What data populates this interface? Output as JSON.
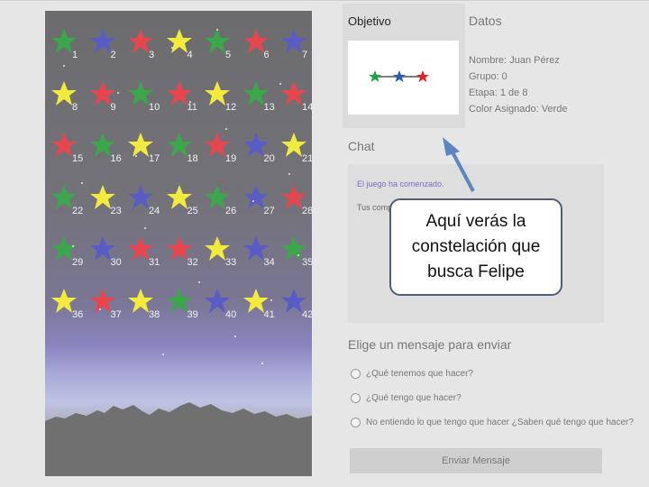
{
  "objective": {
    "title": "Objetivo",
    "colors": [
      "#1fa34a",
      "#2a5bb0",
      "#e0222a"
    ]
  },
  "datos": {
    "title": "Datos",
    "name": "Nombre: Juan Pérez",
    "group": "Grupo: 0",
    "stage": "Etapa: 1 de 8",
    "color": "Color Asignado: Verde"
  },
  "chat": {
    "title": "Chat",
    "message1": "El juego ha comenzado.",
    "message2": "Tus comp"
  },
  "callout": {
    "text": "Aquí verás la constelación que busca Felipe"
  },
  "send": {
    "title": "Elige un mensaje para enviar",
    "options": [
      "¿Qué tenemos que hacer?",
      "¿Qué tengo que hacer?",
      "No entiendo lo que tengo que hacer ¿Saben qué tengo que hacer?"
    ],
    "button": "Enviar Mensaje"
  },
  "palette": {
    "green": "#3aa74a",
    "blue": "#5a5cc6",
    "red": "#e8464e",
    "yellow": "#f2ea3c"
  },
  "stars": [
    {
      "n": "1",
      "c": "green"
    },
    {
      "n": "2",
      "c": "blue"
    },
    {
      "n": "3",
      "c": "red"
    },
    {
      "n": "4",
      "c": "yellow"
    },
    {
      "n": "5",
      "c": "green"
    },
    {
      "n": "6",
      "c": "red"
    },
    {
      "n": "7",
      "c": "blue"
    },
    {
      "n": "8",
      "c": "yellow"
    },
    {
      "n": "9",
      "c": "red"
    },
    {
      "n": "10",
      "c": "green"
    },
    {
      "n": "11",
      "c": "red"
    },
    {
      "n": "12",
      "c": "yellow"
    },
    {
      "n": "13",
      "c": "green"
    },
    {
      "n": "14",
      "c": "red"
    },
    {
      "n": "15",
      "c": "red"
    },
    {
      "n": "16",
      "c": "green"
    },
    {
      "n": "17",
      "c": "yellow"
    },
    {
      "n": "18",
      "c": "green"
    },
    {
      "n": "19",
      "c": "red"
    },
    {
      "n": "20",
      "c": "blue"
    },
    {
      "n": "21",
      "c": "yellow"
    },
    {
      "n": "22",
      "c": "green"
    },
    {
      "n": "23",
      "c": "yellow"
    },
    {
      "n": "24",
      "c": "blue"
    },
    {
      "n": "25",
      "c": "yellow"
    },
    {
      "n": "26",
      "c": "green"
    },
    {
      "n": "27",
      "c": "blue"
    },
    {
      "n": "28",
      "c": "red"
    },
    {
      "n": "29",
      "c": "green"
    },
    {
      "n": "30",
      "c": "blue"
    },
    {
      "n": "31",
      "c": "red"
    },
    {
      "n": "32",
      "c": "red"
    },
    {
      "n": "33",
      "c": "yellow"
    },
    {
      "n": "34",
      "c": "blue"
    },
    {
      "n": "35",
      "c": "green"
    },
    {
      "n": "36",
      "c": "yellow"
    },
    {
      "n": "37",
      "c": "red"
    },
    {
      "n": "38",
      "c": "yellow"
    },
    {
      "n": "39",
      "c": "green"
    },
    {
      "n": "40",
      "c": "blue"
    },
    {
      "n": "41",
      "c": "yellow"
    },
    {
      "n": "42",
      "c": "blue"
    }
  ]
}
